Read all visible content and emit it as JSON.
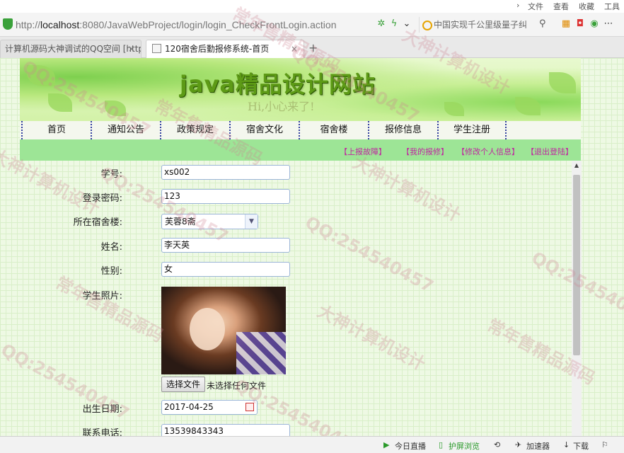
{
  "browser": {
    "top_menu": [
      "文件",
      "查看",
      "收藏",
      "工具"
    ],
    "url": "http://localhost:8080/JavaWebProject/login/login_CheckFrontLogin.action",
    "url_host": "localhost",
    "url_prefix": "http://",
    "url_suffix": ":8080/JavaWebProject/login/login_CheckFrontLogin.action",
    "search_text": "中国实现千公里级量子纠",
    "tabs": [
      {
        "label": "计算机源码大神调试的QQ空间 [http:",
        "close": "×"
      },
      {
        "label": "120宿舍后勤报修系统-首页",
        "close": "×"
      }
    ],
    "new_tab": "+"
  },
  "site": {
    "title": "java精品设计网站",
    "subtitle": "Hi,小心来了!",
    "nav": [
      "首页",
      "通知公告",
      "政策规定",
      "宿舍文化",
      "宿舍楼",
      "报修信息",
      "学生注册"
    ],
    "user_links": [
      "【上报故障】",
      "【我的报修】",
      "【修改个人信息】",
      "【退出登陆】"
    ]
  },
  "form": {
    "student_no_label": "学号:",
    "student_no_value": "xs002",
    "password_label": "登录密码:",
    "password_value": "123",
    "dorm_label": "所在宿舍楼:",
    "dorm_value": "芙蓉8斋",
    "name_label": "姓名:",
    "name_value": "李天英",
    "gender_label": "性别:",
    "gender_value": "女",
    "photo_label": "学生照片:",
    "file_button": "选择文件",
    "file_status": "未选择任何文件",
    "birth_label": "出生日期:",
    "birth_value": "2017-04-25",
    "phone_label": "联系电话:",
    "phone_value": "13539843343"
  },
  "statusbar": {
    "live": "今日直播",
    "guard": "护屏浏览",
    "accelerator": "加速器",
    "download": "下载"
  },
  "watermarks": [
    "常年售精品源码",
    "QQ:254540457",
    "大神计算机设计"
  ],
  "colors": {
    "nav_divider": "#3340a0",
    "subbar": "#9de596",
    "user_link": "#c025a0",
    "title_green": "#5d9a16"
  }
}
